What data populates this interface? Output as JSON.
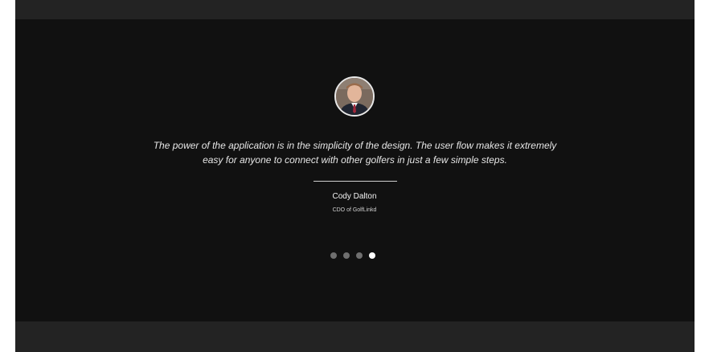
{
  "testimonial": {
    "avatar_alt": "Cody Dalton",
    "quote_line1": "The power of the application is in the simplicity of the design. The user flow makes it extremely",
    "quote_line2": "easy for anyone to connect with other golfers in just a few simple steps.",
    "author_name": "Cody Dalton",
    "author_title": "CDO of GolfLinkd"
  },
  "slider": {
    "total": 4,
    "active_index": 4
  },
  "colors": {
    "background": "#111111",
    "band": "#232323",
    "dot_inactive": "#6f6f6f",
    "dot_active": "#ffffff"
  }
}
